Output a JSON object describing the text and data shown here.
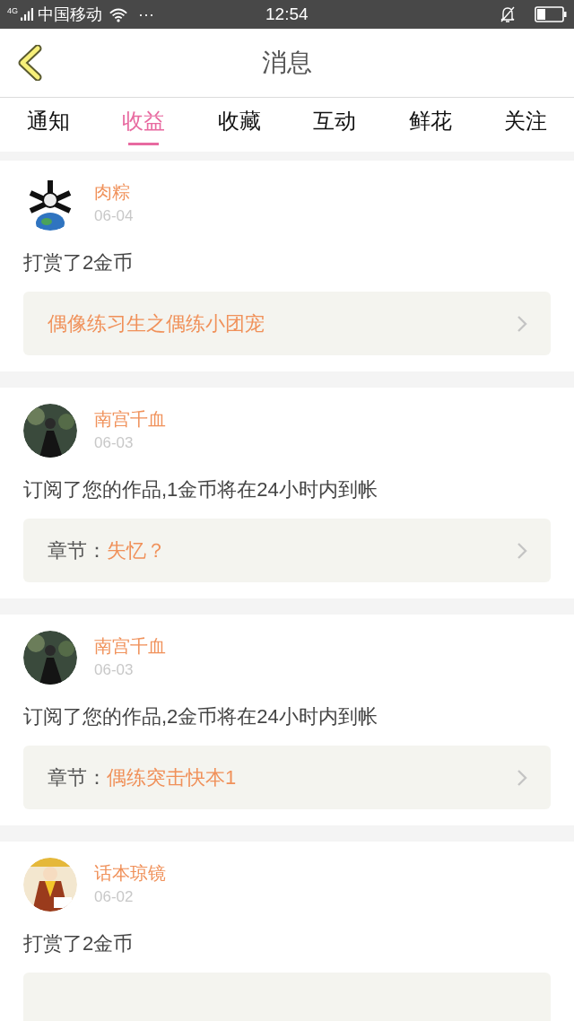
{
  "status_bar": {
    "network": "4G",
    "carrier": "中国移动",
    "dots": "···",
    "time": "12:54"
  },
  "header": {
    "title": "消息"
  },
  "tabs": [
    {
      "label": "通知",
      "selected": false
    },
    {
      "label": "收益",
      "selected": true
    },
    {
      "label": "收藏",
      "selected": false
    },
    {
      "label": "互动",
      "selected": false
    },
    {
      "label": "鲜花",
      "selected": false
    },
    {
      "label": "关注",
      "selected": false
    }
  ],
  "messages": [
    {
      "name": "肉粽",
      "date": "06-04",
      "text": "打赏了2金币",
      "link": {
        "kind": "book",
        "title": "偶像练习生之偶练小团宠"
      }
    },
    {
      "name": "南宫千血",
      "date": "06-03",
      "text": "订阅了您的作品,1金币将在24小时内到帐",
      "link": {
        "kind": "chapter",
        "label": "章节：",
        "title": "失忆？"
      }
    },
    {
      "name": "南宫千血",
      "date": "06-03",
      "text": "订阅了您的作品,2金币将在24小时内到帐",
      "link": {
        "kind": "chapter",
        "label": "章节：",
        "title": "偶练突击快本1"
      }
    },
    {
      "name": "话本琼镜",
      "date": "06-02",
      "text": "打赏了2金币",
      "link": {
        "kind": "book"
      }
    }
  ]
}
